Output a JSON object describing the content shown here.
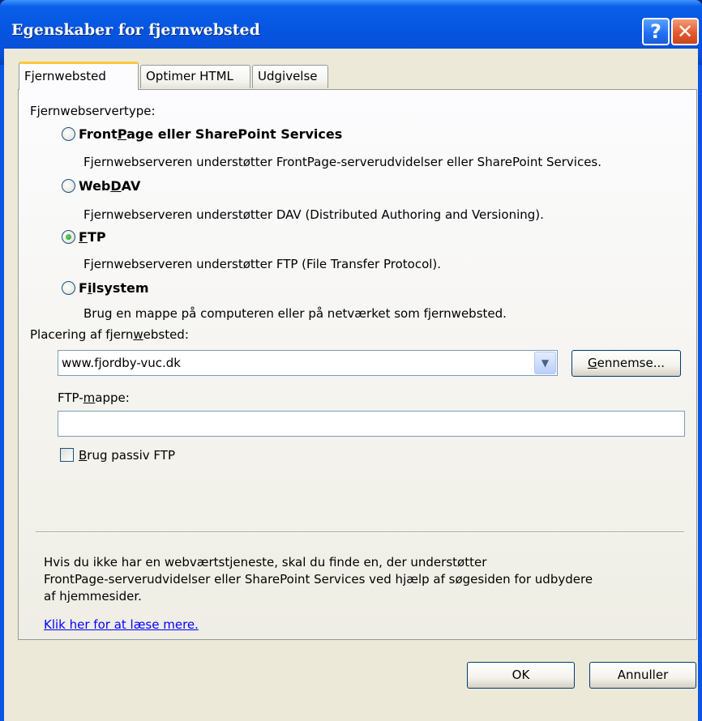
{
  "window": {
    "title": "Egenskaber for fjernwebsted",
    "help_glyph": "?",
    "close_glyph": "✕"
  },
  "tabs": [
    {
      "label": "Fjernwebsted",
      "active": true
    },
    {
      "label": "Optimer HTML",
      "active": false
    },
    {
      "label": "Udgivelse",
      "active": false
    }
  ],
  "server_type": {
    "label": "Fjernwebservertype:",
    "options": [
      {
        "pre": "Front",
        "key": "P",
        "post": "age eller SharePoint Services",
        "description": "Fjernwebserveren understøtter FrontPage-serverudvidelser eller SharePoint Services.",
        "selected": false
      },
      {
        "pre": "Web",
        "key": "D",
        "post": "AV",
        "description": "Fjernwebserveren understøtter DAV (Distributed Authoring and Versioning).",
        "selected": false
      },
      {
        "pre": "",
        "key": "F",
        "post": "TP",
        "description": "Fjernwebserveren understøtter FTP (File Transfer Protocol).",
        "selected": true
      },
      {
        "pre": "F",
        "key": "i",
        "post": "lsystem",
        "description": "Brug en mappe på computeren eller på netværket som fjernwebsted.",
        "selected": false
      }
    ]
  },
  "location": {
    "label_pre": "Placering af fjern",
    "label_key": "w",
    "label_post": "ebsted:",
    "value": "www.fjordby-vuc.dk",
    "browse_key": "G",
    "browse_rest": "ennemse..."
  },
  "ftp_folder": {
    "label_pre": "FTP-",
    "label_key": "m",
    "label_post": "appe:",
    "value": ""
  },
  "passive_ftp": {
    "label_key": "B",
    "label_rest": "rug passiv FTP",
    "checked": false
  },
  "info": {
    "text": "Hvis du ikke har en webværtstjeneste, skal du finde en, der understøtter\nFrontPage-serverudvidelser eller SharePoint Services ved hjælp af søgesiden for udbydere\naf hjemmesider.",
    "link": "Klik her for at læse mere."
  },
  "buttons": {
    "ok": "OK",
    "cancel": "Annuller"
  },
  "colors": {
    "titlebar": "#0554e0",
    "dialog_bg": "#ece9d8",
    "link": "#0000ff",
    "radio_selected": "#21a121"
  }
}
